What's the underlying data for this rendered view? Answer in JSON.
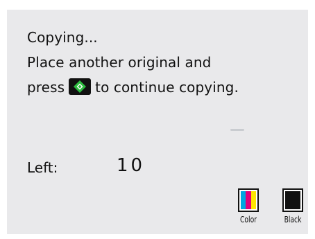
{
  "message": {
    "line1": "Copying...",
    "line2": "Place another original and",
    "line3_before": "press",
    "line3_after": "to continue copying."
  },
  "start_button_icon": "start-diamond-icon",
  "start_button_color": "#2dbb3f",
  "copies_left": {
    "label": "Left:",
    "value": "10"
  },
  "ink": [
    {
      "label": "Color",
      "level": 1.0,
      "colors": [
        "#00a6e0",
        "#e2007a",
        "#ffe600"
      ]
    },
    {
      "label": "Black",
      "level": 1.0,
      "colors": [
        "#111111"
      ]
    }
  ]
}
